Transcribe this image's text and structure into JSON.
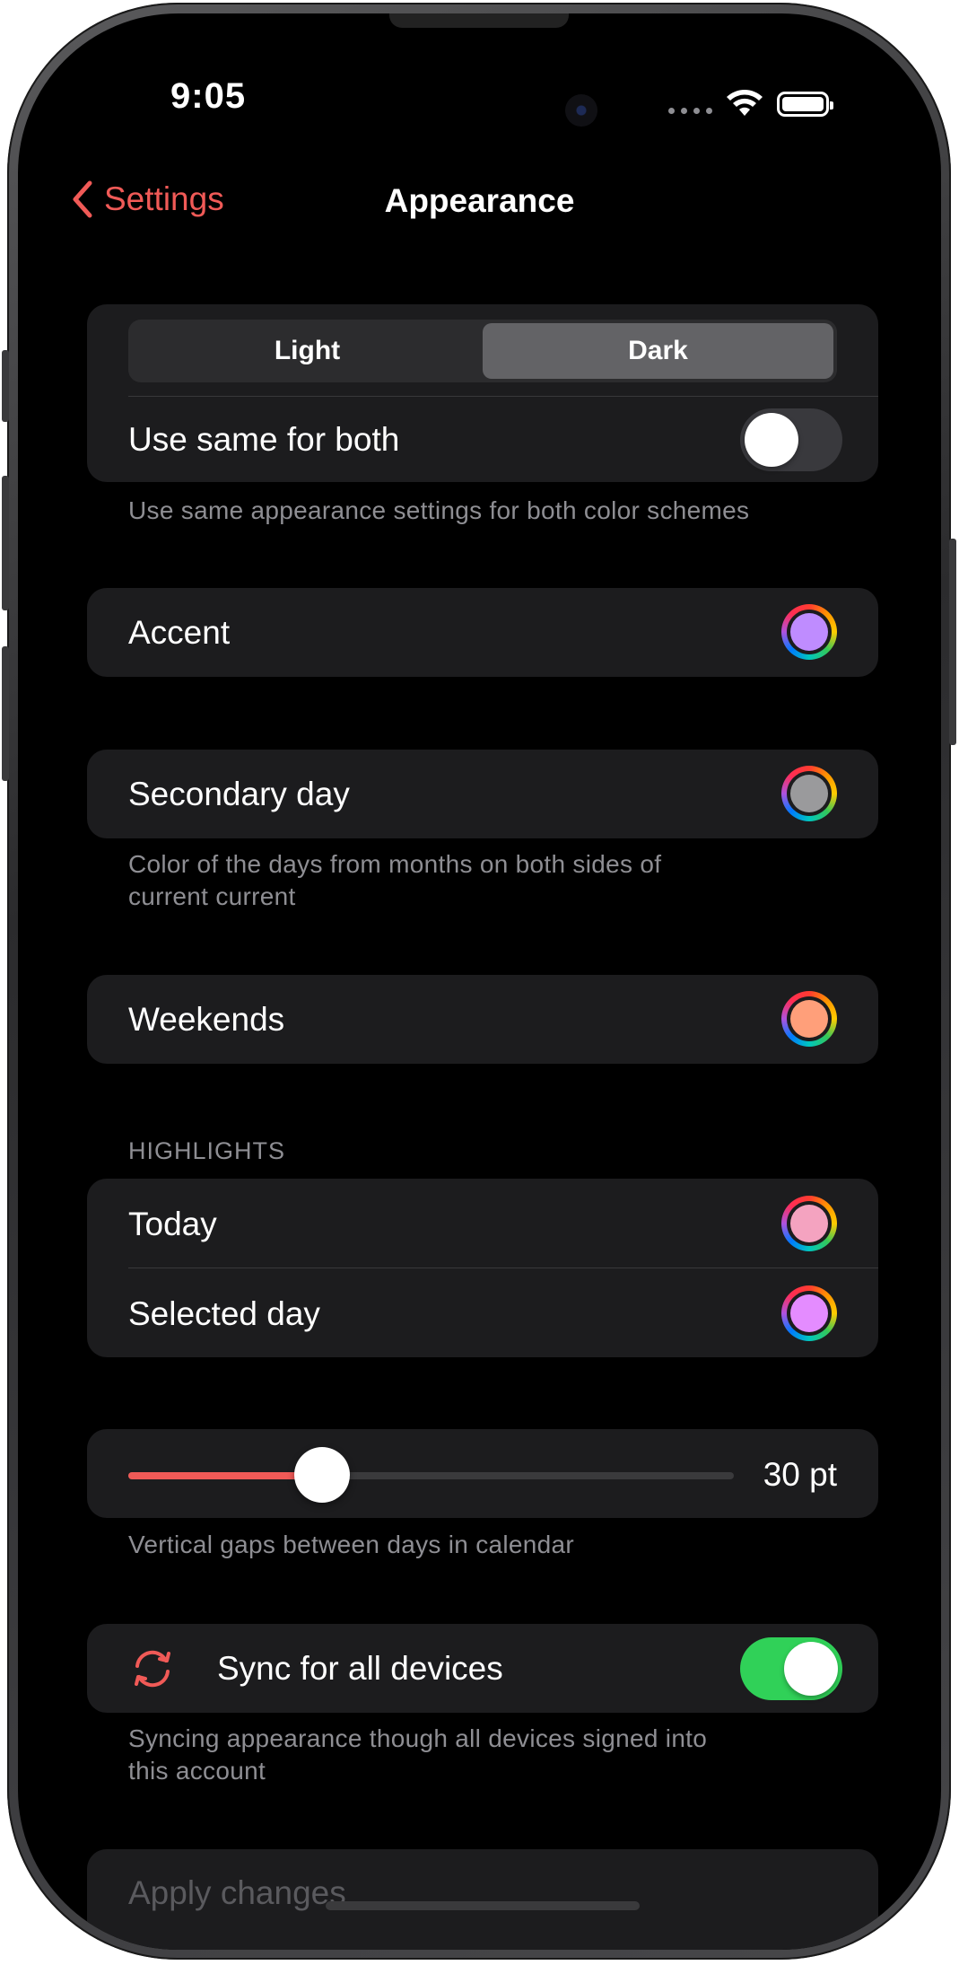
{
  "status_bar": {
    "time": "9:05"
  },
  "nav": {
    "back_label": "Settings",
    "title": "Appearance"
  },
  "scheme": {
    "options": [
      "Light",
      "Dark"
    ],
    "selected": "Dark",
    "same_for_both_label": "Use same for both",
    "same_for_both_on": false,
    "footnote": "Use same appearance settings for both color schemes"
  },
  "accent": {
    "label": "Accent",
    "color": "#bf8cff"
  },
  "secondary_day": {
    "label": "Secondary day",
    "color": "#9a9a9c",
    "footnote_line1": "Color of the days from months on both sides of",
    "footnote_line2": "current current"
  },
  "weekends": {
    "label": "Weekends",
    "color": "#ff9f7a"
  },
  "highlights": {
    "header": "HIGHLIGHTS",
    "today_label": "Today",
    "today_color": "#f4a3c0",
    "selected_label": "Selected day",
    "selected_color": "#e48cff"
  },
  "gap_slider": {
    "value": 30,
    "value_label": "30 pt",
    "fraction": 0.32,
    "footnote": "Vertical gaps between days in calendar"
  },
  "sync": {
    "label": "Sync for all devices",
    "on": true,
    "icon": "sync-icon",
    "footnote_line1": "Syncing appearance though all devices signed into",
    "footnote_line2": "this account"
  },
  "apply_label": "Apply changes",
  "colors": {
    "accent_red": "#f05a57",
    "toggle_on": "#30d158",
    "card_bg": "#1c1c1e"
  }
}
